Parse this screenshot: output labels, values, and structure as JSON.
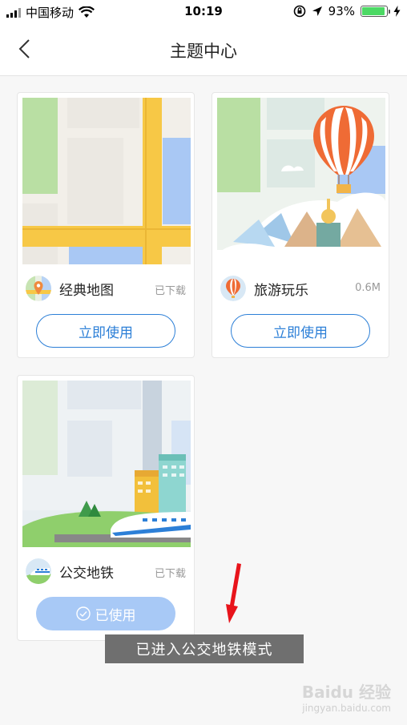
{
  "status_bar": {
    "carrier": "中国移动",
    "time": "10:19",
    "battery_percent": "93%",
    "battery_level": 0.93,
    "icons": [
      "signal-icon",
      "wifi-icon",
      "rotation-lock-icon",
      "location-icon",
      "battery-icon",
      "charging-icon"
    ]
  },
  "nav": {
    "title": "主题中心",
    "back_icon": "chevron-left-icon"
  },
  "themes": [
    {
      "name": "经典地图",
      "meta": "已下载",
      "button": "立即使用",
      "state": "available"
    },
    {
      "name": "旅游玩乐",
      "meta": "0.6M",
      "button": "立即使用",
      "state": "available"
    },
    {
      "name": "公交地铁",
      "meta": "已下载",
      "button": "已使用",
      "state": "in-use"
    }
  ],
  "toast": "已进入公交地铁模式",
  "watermark": {
    "line1": "Baidu 经验",
    "line2": "jingyan.baidu.com"
  },
  "colors": {
    "accent": "#2c7fd7",
    "used_button": "#a8c9f6",
    "road_yellow": "#f7c846",
    "water_blue": "#a9c8f4",
    "park_green": "#b9dfa3"
  }
}
